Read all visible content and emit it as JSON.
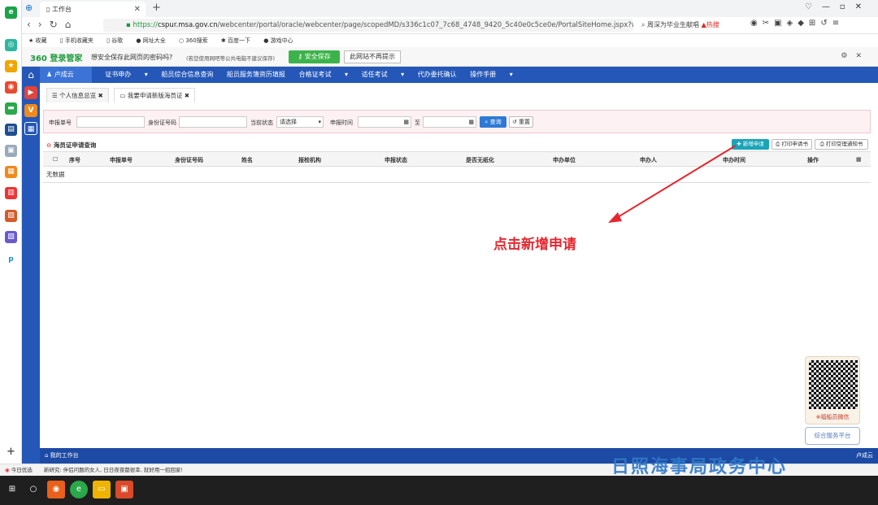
{
  "browser": {
    "tab_title": "工作台",
    "url_secure": "https://",
    "url_host": "cspur.msa.gov.cn",
    "url_path": "/webcenter/portal/oracle/webcenter/page/scopedMD/s336c1c07_7c68_4748_9420_5c40e0c5ce0e/PortalSiteHome.jspx?wc.",
    "search_text": "周深为毕业生献唱",
    "search_hot": "热搜",
    "bookmarks": [
      "收藏",
      "手机收藏夹",
      "谷歌",
      "网址大全",
      "360搜索",
      "百度一下",
      "游戏中心"
    ]
  },
  "password_bar": {
    "logo": "360 登录管家",
    "question": "想安全保存此网页的密码吗?",
    "note": "(若您使用网吧等公共电脑不建议保存)",
    "save_label": "安全保存",
    "never_label": "此网站不再提示"
  },
  "menu": {
    "items": [
      "卢成云",
      "证书申办",
      "船员综合信息查询",
      "船员服务簿资历填报",
      "合格证考试",
      "适任考试",
      "代办委托确认",
      "操作手册"
    ]
  },
  "subtabs": [
    "个人信息总览",
    "我要申请新版海员证"
  ],
  "filter": {
    "apply_no_label": "申报单号",
    "id_label": "身份证号码",
    "status_label": "当前状态",
    "status_value": "请选择",
    "time_label": "申报时间",
    "to_label": "至",
    "query_label": "查询",
    "reset_label": "重置"
  },
  "section": {
    "title": "海员证申请查询",
    "add_label": "新增申请",
    "print_apply_label": "打印申请书",
    "print_notice_label": "打印受理通知书"
  },
  "table": {
    "headers": [
      "序号",
      "申报单号",
      "身份证号码",
      "姓名",
      "报检机构",
      "申报状态",
      "是否无纸化",
      "申办单位",
      "申办人",
      "申办时间",
      "操作"
    ],
    "empty_text": "无数据"
  },
  "annotation": "点击新增申请",
  "qr_label": "※福船员微信",
  "service_button": "综合服务平台",
  "footer": {
    "workbench": "我的工作台",
    "user": "卢成云"
  },
  "statusbar": {
    "left": "今日优选",
    "news": "新研究: 伴侣问题的女人, 日日夜夜都很幸, 就好用一招回家!"
  },
  "watermark": "日照海事局政务中心"
}
